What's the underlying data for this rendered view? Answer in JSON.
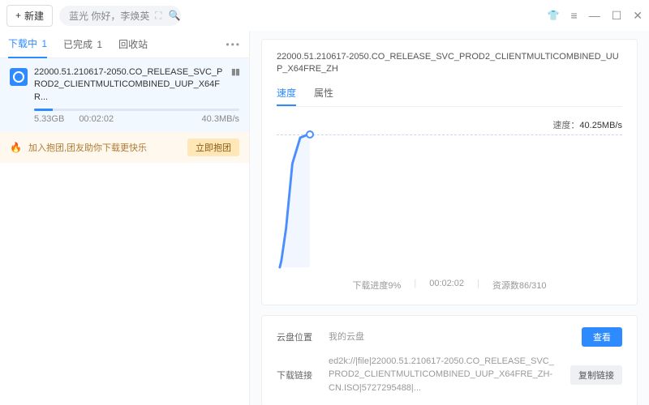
{
  "topbar": {
    "new_btn": "新建",
    "search_text": "蓝光  你好，李焕英"
  },
  "tabs": {
    "downloading": "下载中",
    "downloading_count": "1",
    "finished": "已完成",
    "finished_count": "1",
    "recycle": "回收站"
  },
  "download": {
    "name_line1": "22000.51.210617-2050.CO_RELEASE_SVC_PROD2_CLIENTMULTICOMBINED_UUP_X64FR...",
    "size": "5.33GB",
    "elapsed": "00:02:02",
    "speed": "40.3MB/s",
    "progress_pct": 9
  },
  "promo": {
    "text": "加入抱团,团友助你下载更快乐",
    "btn": "立即抱团"
  },
  "detail": {
    "title": "22000.51.210617-2050.CO_RELEASE_SVC_PROD2_CLIENTMULTICOMBINED_UUP_X64FRE_ZH",
    "tab_speed": "速度",
    "tab_attr": "属性",
    "speed_label": "速度：",
    "speed_value": "40.25MB/s",
    "progress_label": "下载进度9%",
    "elapsed": "00:02:02",
    "resources": "资源数86/310"
  },
  "info": {
    "cloud_label": "云盘位置",
    "cloud_value": "我的云盘",
    "view_btn": "查看",
    "link_label": "下载链接",
    "link_value": "ed2k://|file|22000.51.210617-2050.CO_RELEASE_SVC_PROD2_CLIENTMULTICOMBINED_UUP_X64FRE_ZH-CN.ISO|5727295488|...",
    "copy_btn": "复制链接"
  },
  "chart_data": {
    "type": "line",
    "title": "",
    "xlabel": "",
    "ylabel": "速度 (MB/s)",
    "ylim": [
      0,
      45
    ],
    "x": [
      0,
      2,
      4,
      5,
      6,
      8
    ],
    "values": [
      0,
      5,
      30,
      41,
      40.25,
      40.25
    ],
    "current": 40.25
  }
}
